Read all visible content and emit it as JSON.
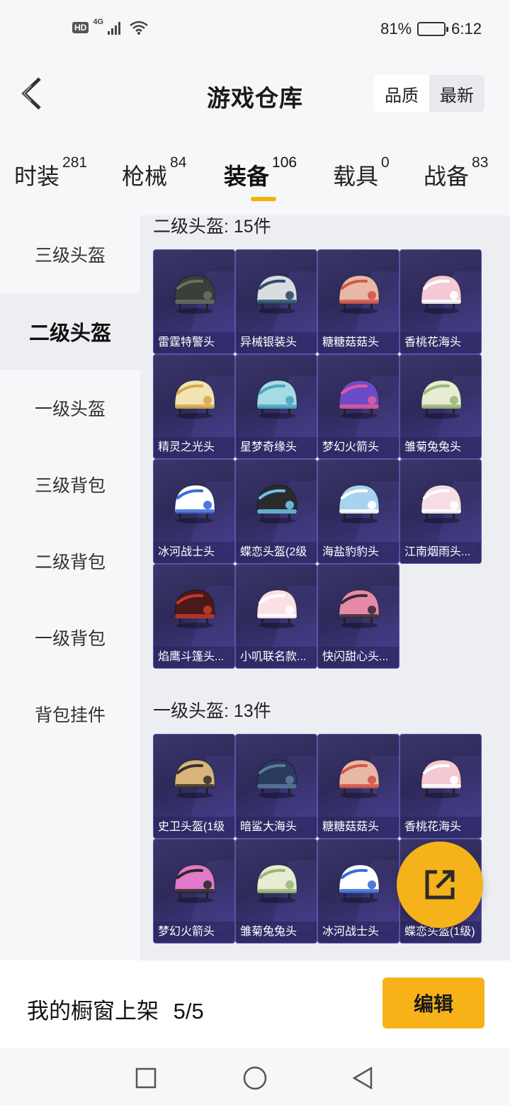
{
  "status_bar": {
    "hd": "HD",
    "network": "4G",
    "battery_percent": "81%",
    "battery_level": 0.81,
    "time": "6:12"
  },
  "header": {
    "title": "游戏仓库",
    "sort_options": [
      "品质",
      "最新"
    ],
    "sort_selected": "品质"
  },
  "tabs": [
    {
      "label": "时装",
      "count": "281"
    },
    {
      "label": "枪械",
      "count": "84"
    },
    {
      "label": "装备",
      "count": "106",
      "active": true
    },
    {
      "label": "载具",
      "count": "0"
    },
    {
      "label": "战备",
      "count": "83"
    }
  ],
  "sidebar": {
    "items": [
      "三级头盔",
      "二级头盔",
      "一级头盔",
      "三级背包",
      "二级背包",
      "一级背包",
      "背包挂件"
    ],
    "active": "二级头盔"
  },
  "sections": [
    {
      "title": "二级头盔: 15件",
      "items": [
        {
          "name": "雷霆特警头",
          "color": "#3b3f3a",
          "accent": "#6a6e64"
        },
        {
          "name": "异械银装头",
          "color": "#d9dde0",
          "accent": "#2a4d6b"
        },
        {
          "name": "糖糖菇菇头",
          "color": "#e8b8a6",
          "accent": "#d2554a"
        },
        {
          "name": "香桃花海头",
          "color": "#f4c9d4",
          "accent": "#ffffff"
        },
        {
          "name": "精灵之光头",
          "color": "#f2e3b5",
          "accent": "#d6a94c"
        },
        {
          "name": "星梦奇缘头",
          "color": "#a7dbe4",
          "accent": "#4aa8bf"
        },
        {
          "name": "梦幻火箭头",
          "color": "#6b4bc6",
          "accent": "#e05aa0"
        },
        {
          "name": "雏菊兔兔头",
          "color": "#e7ecd2",
          "accent": "#9bb77a"
        },
        {
          "name": "冰河战士头",
          "color": "#ffffff",
          "accent": "#3a6ad9"
        },
        {
          "name": "蝶恋头盔(2级",
          "color": "#2b2b2b",
          "accent": "#6cc6e6"
        },
        {
          "name": "海盐豹豹头",
          "color": "#a8d3ef",
          "accent": "#ffffff"
        },
        {
          "name": "江南烟雨头...",
          "color": "#f6dde4",
          "accent": "#ffffff"
        },
        {
          "name": "焰鹰斗篷头...",
          "color": "#4a1a1a",
          "accent": "#c23a2c"
        },
        {
          "name": "小叽联名款...",
          "color": "#fbe0e6",
          "accent": "#ffffff"
        },
        {
          "name": "快闪甜心头...",
          "color": "#e68aa8",
          "accent": "#3a2a3a"
        }
      ]
    },
    {
      "title": "一级头盔: 13件",
      "items": [
        {
          "name": "史卫头盔(1级",
          "color": "#d8b57a",
          "accent": "#3a3030"
        },
        {
          "name": "暗鲨大海头",
          "color": "#2a3a5a",
          "accent": "#5a7aa0"
        },
        {
          "name": "糖糖菇菇头",
          "color": "#e8b8a6",
          "accent": "#d2554a"
        },
        {
          "name": "香桃花海头",
          "color": "#f4c9d4",
          "accent": "#ffffff"
        },
        {
          "name": "梦幻火箭头",
          "color": "#e27ac9",
          "accent": "#2a2a2a"
        },
        {
          "name": "雏菊兔兔头",
          "color": "#e7ecd2",
          "accent": "#9bb77a"
        },
        {
          "name": "冰河战士头",
          "color": "#ffffff",
          "accent": "#3a6ad9"
        },
        {
          "name": "蝶恋头盔(1级)",
          "color": "#2b2b2b",
          "accent": "#6cc6e6"
        }
      ]
    }
  ],
  "bottom_bar": {
    "label": "我的橱窗上架",
    "count": "5/5",
    "edit_label": "编辑"
  },
  "colors": {
    "accent": "#f5b21a",
    "card_bg": "#2d2a5a"
  }
}
